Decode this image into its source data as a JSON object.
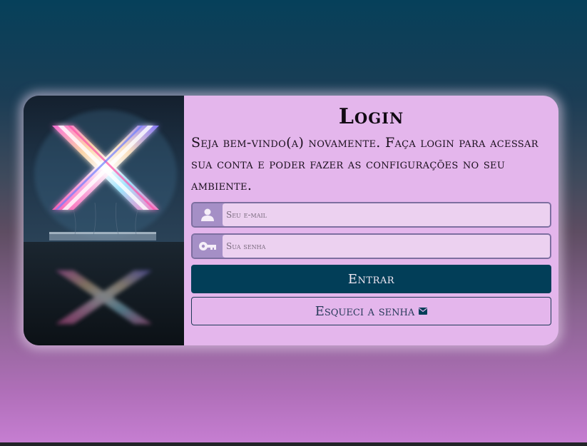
{
  "login": {
    "title": "Login",
    "welcome_text": "Seja bem-vindo(a) novamente. Faça login para acessar sua conta e poder fazer as configurações no seu ambiente.",
    "email": {
      "placeholder": "Seu e-mail",
      "value": "",
      "icon": "user-icon"
    },
    "password": {
      "placeholder": "Sua senha",
      "value": "",
      "icon": "key-icon"
    },
    "submit_label": "Entrar",
    "forgot_label": "Esqueci a senha",
    "forgot_icon": "mail-icon"
  },
  "image": {
    "description_icon": "neon-x-sign"
  },
  "colors": {
    "card_bg": "#e4b6ec",
    "primary_button": "#023e58",
    "input_bg": "#ecd1f0",
    "icon_bg": "#a58fc6"
  }
}
